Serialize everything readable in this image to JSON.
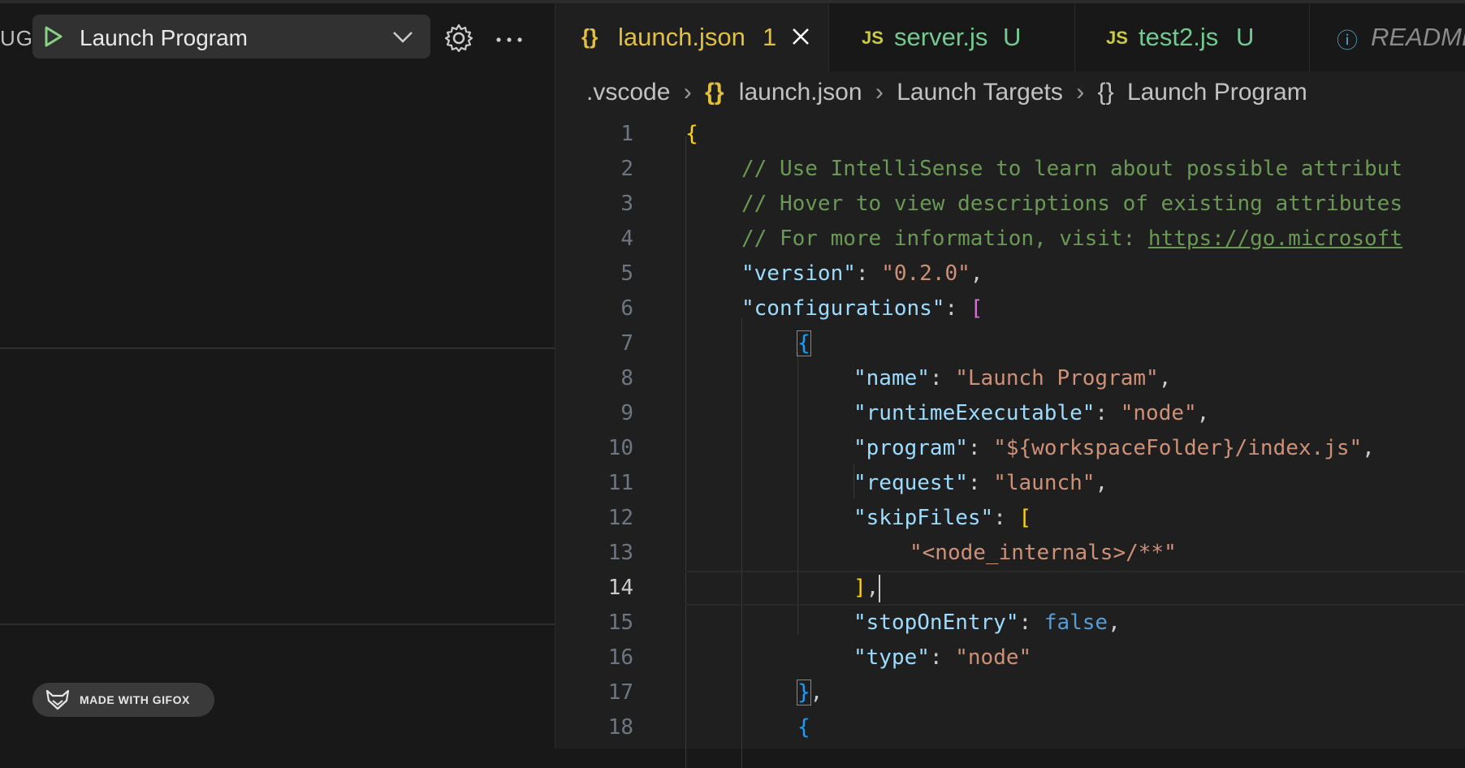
{
  "sidebar": {
    "title_fragment": "UG",
    "launch_config": "Launch Program",
    "gifox_badge": "MADE WITH GIFOX"
  },
  "tabs": [
    {
      "icon": "{}",
      "label": "launch.json",
      "badge": "1",
      "icon_color": "#e2c03f",
      "label_color": "#e2c03f",
      "active": true
    },
    {
      "icon": "JS",
      "label": "server.js",
      "badge": "U",
      "icon_color": "#cbcb41",
      "label_color": "#73c991",
      "active": false
    },
    {
      "icon": "JS",
      "label": "test2.js",
      "badge": "U",
      "icon_color": "#cbcb41",
      "label_color": "#73c991",
      "active": false
    },
    {
      "icon": "ⓘ",
      "label": "README",
      "badge": "",
      "icon_color": "#519aba",
      "label_color": "#8a8a8a",
      "active": false
    }
  ],
  "breadcrumb": {
    "folder": ".vscode",
    "file": "launch.json",
    "section": "Launch Targets",
    "item": "Launch Program",
    "json_icon": "{}",
    "obj_icon": "{}"
  },
  "editor": {
    "current_line": "14",
    "lines": {
      "l1": {
        "num": "1",
        "t1": "{"
      },
      "l2": {
        "num": "2",
        "t1": "// Use IntelliSense to learn about possible attribut"
      },
      "l3": {
        "num": "3",
        "t1": "// Hover to view descriptions of existing attributes"
      },
      "l4": {
        "num": "4",
        "t1": "// For more information, visit: ",
        "t2": "https://go.microsoft"
      },
      "l5": {
        "num": "5",
        "t1": "\"version\"",
        "t2": ": ",
        "t3": "\"0.2.0\"",
        "t4": ","
      },
      "l6": {
        "num": "6",
        "t1": "\"configurations\"",
        "t2": ": ",
        "t3": "["
      },
      "l7": {
        "num": "7",
        "t1": "{"
      },
      "l8": {
        "num": "8",
        "t1": "\"name\"",
        "t2": ": ",
        "t3": "\"Launch Program\"",
        "t4": ","
      },
      "l9": {
        "num": "9",
        "t1": "\"runtimeExecutable\"",
        "t2": ": ",
        "t3": "\"node\"",
        "t4": ","
      },
      "l10": {
        "num": "10",
        "t1": "\"program\"",
        "t2": ": ",
        "t3": "\"${workspaceFolder}/index.js\"",
        "t4": ","
      },
      "l11": {
        "num": "11",
        "t1": "\"request\"",
        "t2": ": ",
        "t3": "\"launch\"",
        "t4": ","
      },
      "l12": {
        "num": "12",
        "t1": "\"skipFiles\"",
        "t2": ": ",
        "t3": "["
      },
      "l13": {
        "num": "13",
        "t1": "\"<node_internals>/**\""
      },
      "l14": {
        "num": "14",
        "t1": "]",
        "t2": ","
      },
      "l15": {
        "num": "15",
        "t1": "\"stopOnEntry\"",
        "t2": ": ",
        "t3": "false",
        "t4": ","
      },
      "l16": {
        "num": "16",
        "t1": "\"type\"",
        "t2": ": ",
        "t3": "\"node\""
      },
      "l17": {
        "num": "17",
        "t1": "}",
        "t2": ","
      },
      "l18": {
        "num": "18",
        "t1": "{"
      }
    }
  },
  "colors": {
    "background": "#1f1f1f",
    "comment": "#6a9955",
    "key": "#9cdcfe",
    "string": "#ce9178",
    "keyword": "#569cd6",
    "modified_untracked": "#73c991"
  }
}
